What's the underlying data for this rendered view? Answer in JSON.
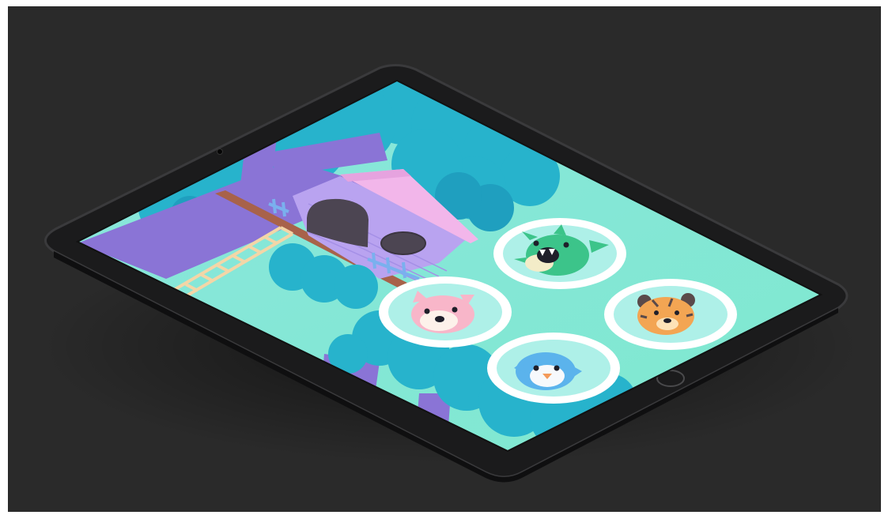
{
  "scene": {
    "description_type": "tablet-mockup",
    "background_color": "#2a2a2a",
    "device": {
      "bezel_color": "#1b1b1c",
      "edge_color": "#3a3a3c",
      "has_home_button": true,
      "has_front_camera": true
    },
    "app_screen": {
      "sky_color": "#7fe3dc",
      "foliage_color": "#27b3cc",
      "trunk_color": "#8a74d6",
      "house_wall_color": "#b9a3f0",
      "house_roof_color": "#f2b6ea",
      "ladder_color": "#f3d6a7",
      "characters": [
        {
          "id": "monster",
          "icon": "green-monster-icon",
          "color": "#3cc48a"
        },
        {
          "id": "fox",
          "icon": "pink-fox-icon",
          "color": "#f8b6c9"
        },
        {
          "id": "tiger",
          "icon": "orange-tiger-icon",
          "color": "#f3a553"
        },
        {
          "id": "penguin",
          "icon": "blue-penguin-icon",
          "color": "#5bb3ec"
        }
      ]
    }
  }
}
